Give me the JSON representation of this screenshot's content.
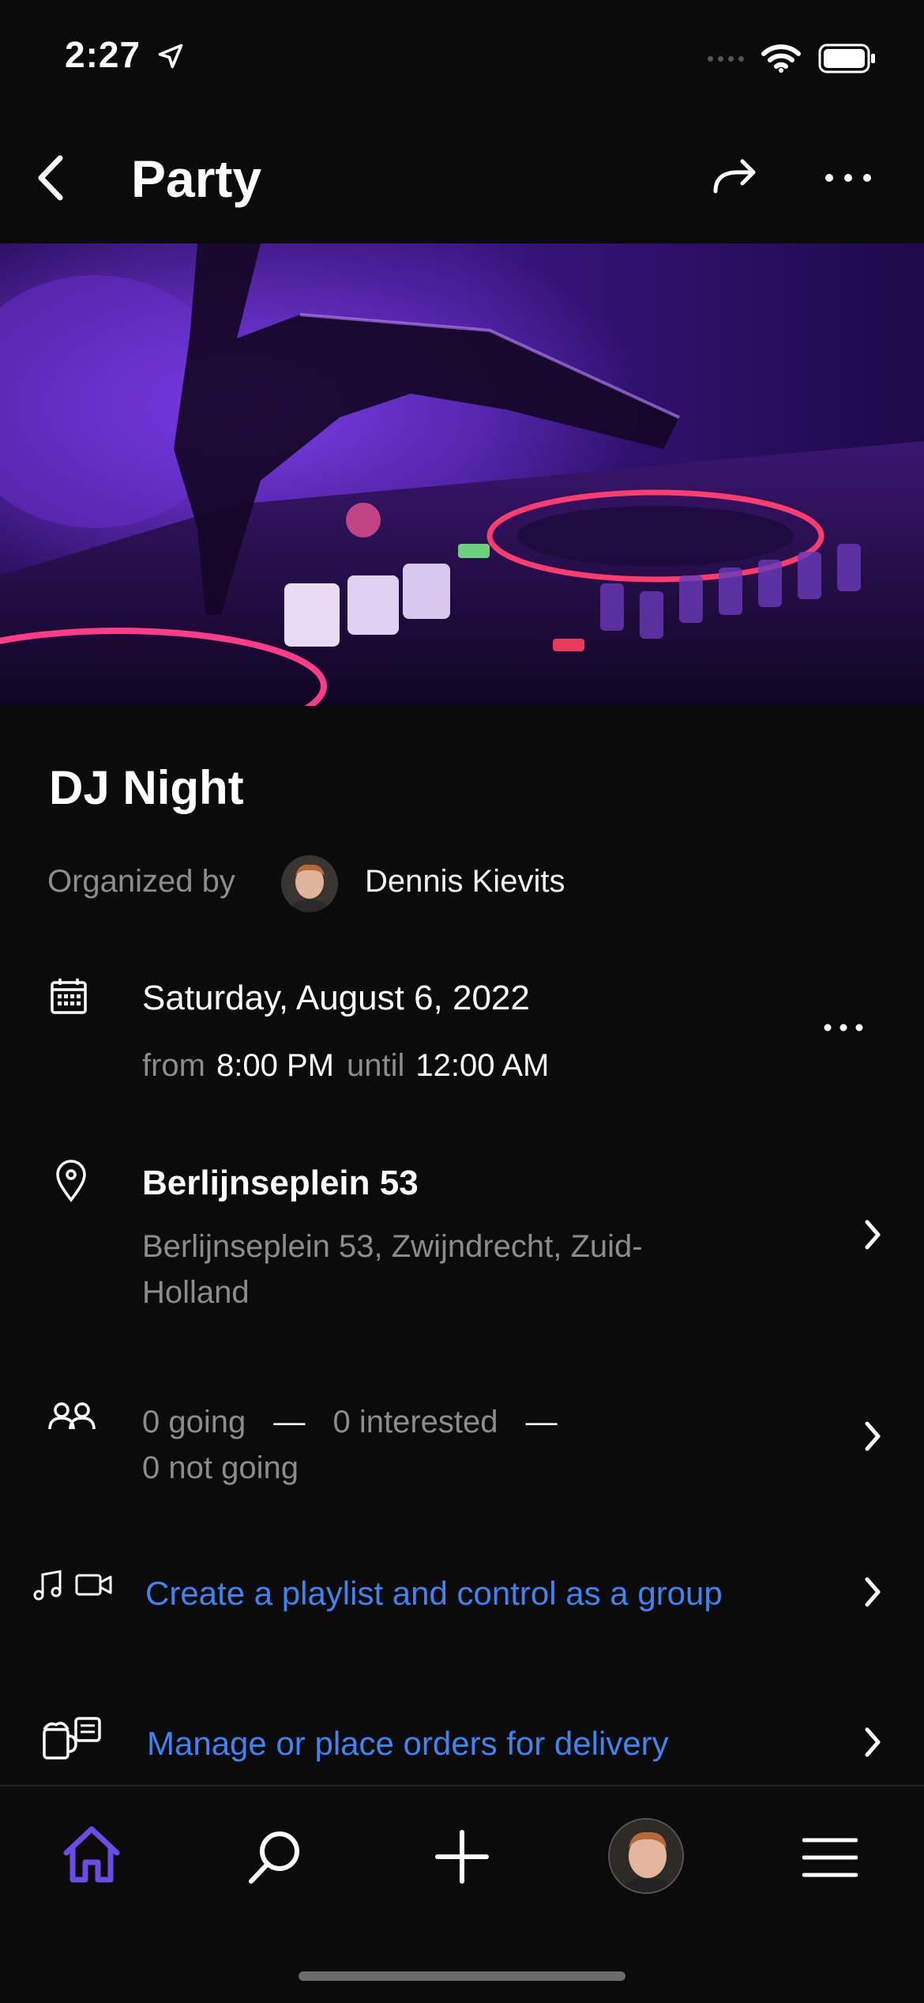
{
  "status_bar": {
    "time": "2:27"
  },
  "header": {
    "title": "Party"
  },
  "event": {
    "title": "DJ Night",
    "organized_by_label": "Organized by",
    "organizer_name": "Dennis Kievits",
    "date": "Saturday, August 6, 2022",
    "from_label": "from",
    "start_time": "8:00 PM",
    "until_label": "until",
    "end_time": "12:00 AM",
    "location_title": "Berlijnseplein 53",
    "location_address": "Berlijnseplein 53, Zwijndrecht, Zuid-Holland",
    "attendance": {
      "going": "0 going",
      "sep1": "—",
      "interested": "0 interested",
      "sep2": "—",
      "not_going": "0 not going"
    },
    "playlist_link": "Create a playlist and control as a group",
    "orders_link": "Manage or place orders for delivery"
  },
  "colors": {
    "link": "#3f84f0",
    "home_active": "#6a4de8",
    "background": "#0b0b0c"
  }
}
